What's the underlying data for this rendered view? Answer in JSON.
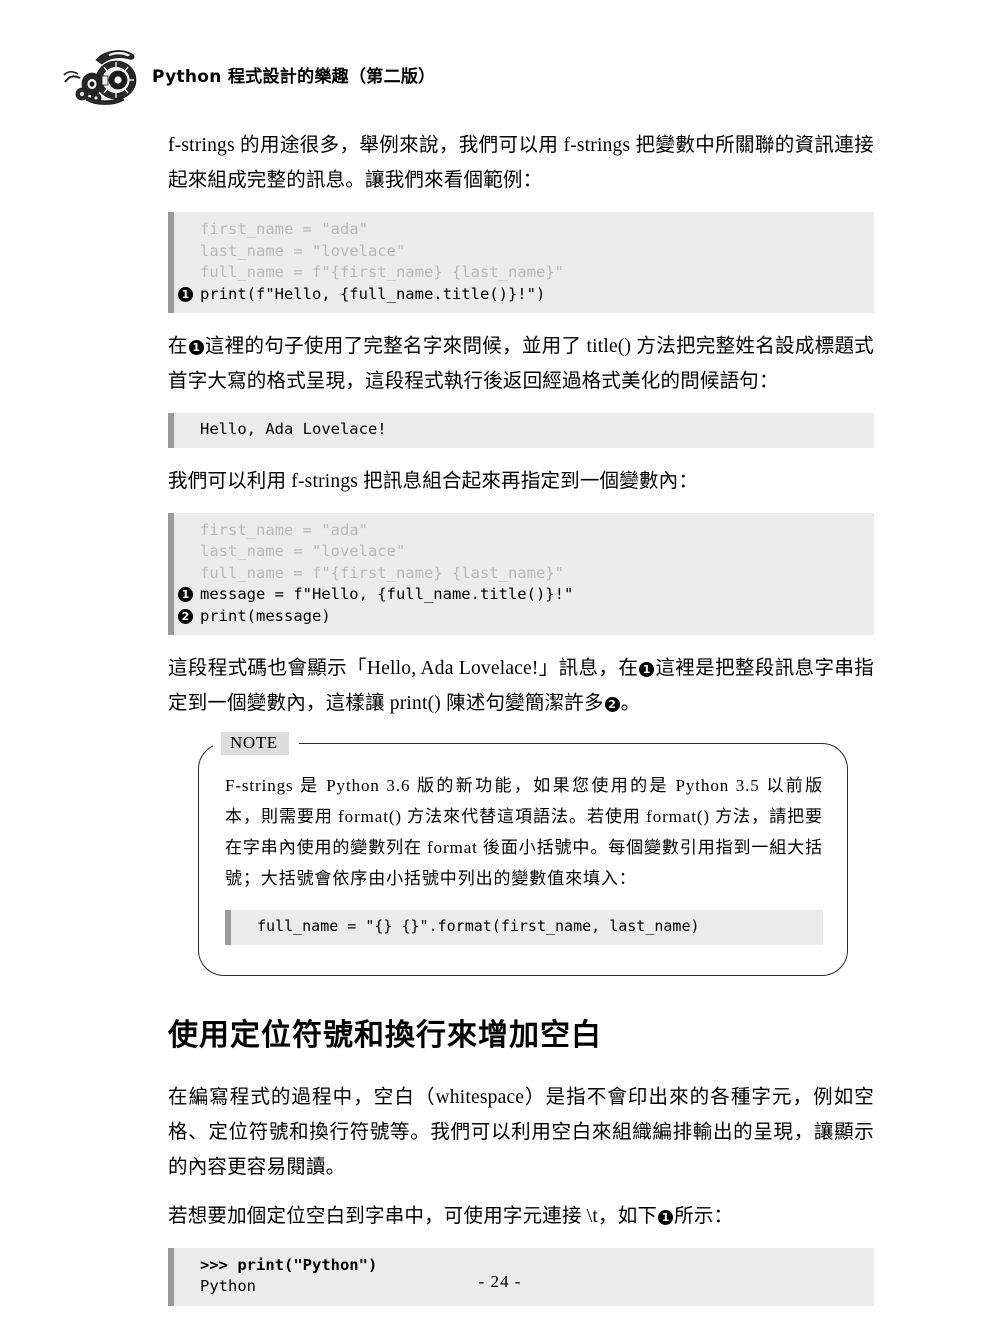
{
  "header": {
    "logo_icon": "mechanical-camera-illustration",
    "title": "Python 程式設計的樂趣（第二版）"
  },
  "content": {
    "para1": "f-strings 的用途很多，舉例來說，我們可以用 f-strings 把變數中所關聯的資訊連接起來組成完整的訊息。讓我們來看個範例：",
    "code1": {
      "lines": [
        {
          "marker": "",
          "text": "first_name = \"ada\"",
          "dim": true,
          "bold": false
        },
        {
          "marker": "",
          "text": "last_name = \"lovelace\"",
          "dim": true,
          "bold": false
        },
        {
          "marker": "",
          "text": "full_name = f\"{first_name} {last_name}\"",
          "dim": true,
          "bold": false
        },
        {
          "marker": "❶",
          "text": "print(f\"Hello, {full_name.title()}!\")",
          "dim": false,
          "bold": false
        }
      ]
    },
    "para2_a": "在",
    "para2_marker": "❶",
    "para2_b": "這裡的句子使用了完整名字來問候，並用了 title() 方法把完整姓名設成標題式首字大寫的格式呈現，這段程式執行後返回經過格式美化的問候語句：",
    "output1": {
      "lines": [
        {
          "marker": "",
          "text": "Hello, Ada Lovelace!",
          "dim": false,
          "bold": false
        }
      ]
    },
    "para3": "我們可以利用 f-strings 把訊息組合起來再指定到一個變數內：",
    "code2": {
      "lines": [
        {
          "marker": "",
          "text": "first_name = \"ada\"",
          "dim": true,
          "bold": false
        },
        {
          "marker": "",
          "text": "last_name = \"lovelace\"",
          "dim": true,
          "bold": false
        },
        {
          "marker": "",
          "text": "full_name = f\"{first_name} {last_name}\"",
          "dim": true,
          "bold": false
        },
        {
          "marker": "❶",
          "text": "message = f\"Hello, {full_name.title()}!\"",
          "dim": false,
          "bold": false
        },
        {
          "marker": "❷",
          "text": "print(message)",
          "dim": false,
          "bold": false
        }
      ]
    },
    "para4_a": "這段程式碼也會顯示「Hello, Ada Lovelace!」訊息，在",
    "para4_marker1": "❶",
    "para4_b": "這裡是把整段訊息字串指定到一個變數內，這樣讓 print() 陳述句變簡潔許多",
    "para4_marker2": "❷",
    "para4_c": "。"
  },
  "note": {
    "label": "NOTE",
    "text": "F-strings 是 Python 3.6 版的新功能，如果您使用的是 Python 3.5 以前版本，則需要用 format() 方法來代替這項語法。若使用 format() 方法，請把要在字串內使用的變數列在 format 後面小括號中。每個變數引用指到一組大括號；大括號會依序由小括號中列出的變數值來填入：",
    "code": {
      "lines": [
        {
          "marker": "",
          "text": "full_name = \"{} {}\".format(first_name, last_name)",
          "dim": false,
          "bold": false
        }
      ]
    }
  },
  "section": {
    "heading": "使用定位符號和換行來增加空白",
    "para1": "在編寫程式的過程中，空白（whitespace）是指不會印出來的各種字元，例如空格、定位符號和換行符號等。我們可以利用空白來組織編排輸出的呈現，讓顯示的內容更容易閱讀。",
    "para2_a": "若想要加個定位空白到字串中，可使用字元連接 \\t，如下",
    "para2_marker": "❶",
    "para2_b": "所示：",
    "code": {
      "lines": [
        {
          "marker": "",
          "text": ">>> print(\"Python\")",
          "dim": false,
          "bold": true
        },
        {
          "marker": "",
          "text": "Python",
          "dim": false,
          "bold": false
        }
      ]
    }
  },
  "footer": {
    "page_number": "- 24 -"
  }
}
